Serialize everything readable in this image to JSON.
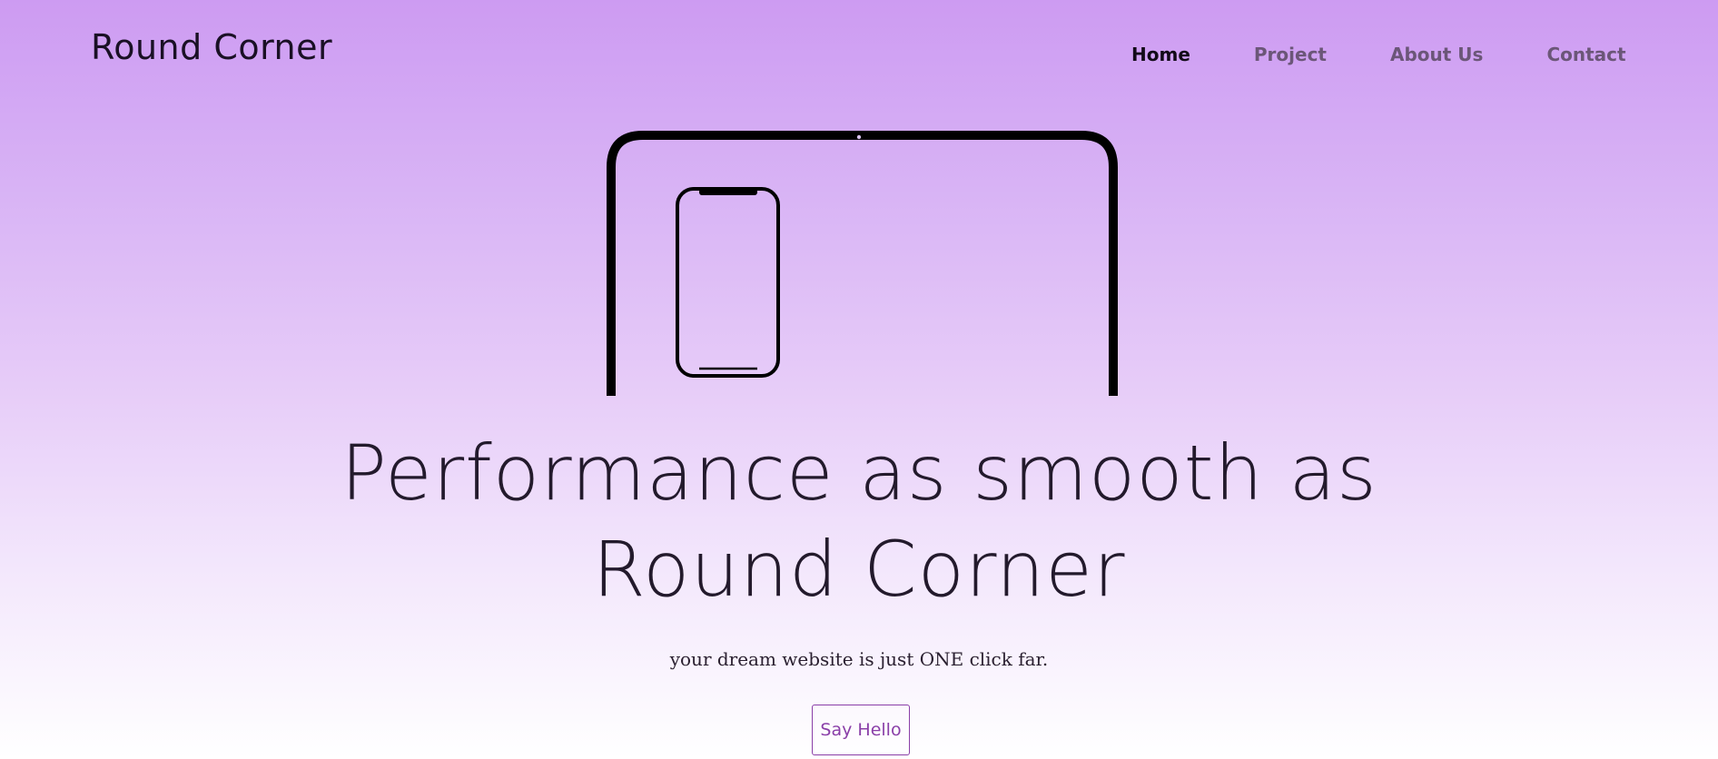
{
  "header": {
    "brand": "Round Corner",
    "nav": [
      {
        "label": "Home",
        "active": true
      },
      {
        "label": "Project"
      },
      {
        "label": "About Us"
      },
      {
        "label": "Contact"
      }
    ]
  },
  "hero": {
    "headline_line1": "Performance as smooth as",
    "headline_line2": "Round Corner",
    "tagline": "your dream website is just ONE click far.",
    "cta_label": "Say Hello",
    "illustration": {
      "tablet_icon": "tablet-outline-icon",
      "phone_icon": "phone-outline-icon"
    }
  },
  "colors": {
    "gradient_top": "#cd9bf2",
    "gradient_bottom": "#ffffff",
    "accent": "#8a3fa8",
    "text_dark": "#231a2c",
    "nav_muted": "#6b5678"
  }
}
